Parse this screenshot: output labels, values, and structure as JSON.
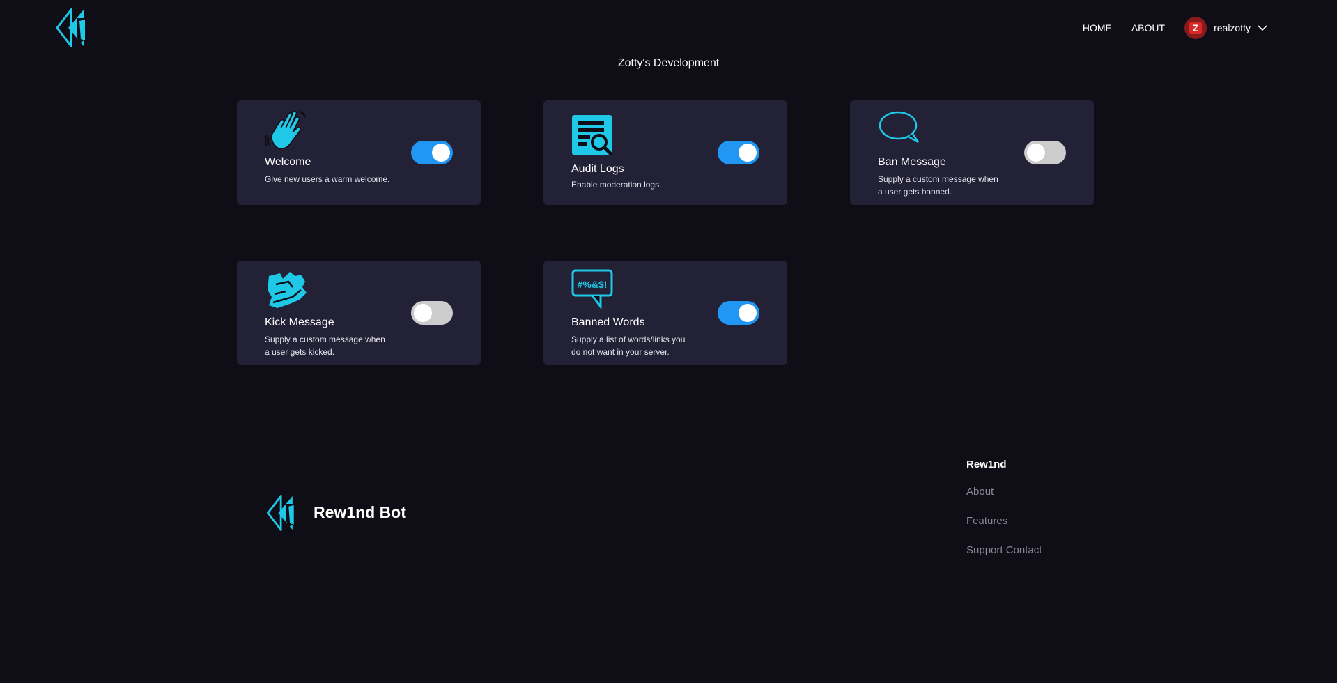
{
  "header": {
    "nav": [
      "HOME",
      "ABOUT"
    ],
    "username": "realzotty",
    "avatar_letter": "Z",
    "page_title": "Zotty's Development"
  },
  "cards": [
    {
      "title": "Welcome",
      "desc": "Give new users a warm welcome.",
      "enabled": true,
      "icon": "wave-hand-icon"
    },
    {
      "title": "Audit Logs",
      "desc": "Enable moderation logs.",
      "enabled": true,
      "icon": "audit-document-icon"
    },
    {
      "title": "Ban Message",
      "desc": "Supply a custom message when a user gets banned.",
      "enabled": false,
      "icon": "speech-bubble-icon"
    },
    {
      "title": "Kick Message",
      "desc": "Supply a custom message when a user gets kicked.",
      "enabled": false,
      "icon": "kick-shoe-icon"
    },
    {
      "title": "Banned Words",
      "desc": "Supply a list of words/links you do not want in your server.",
      "enabled": true,
      "icon": "censored-bubble-icon",
      "icon_text": "#%&$!"
    }
  ],
  "footer": {
    "brand": "Rew1nd Bot",
    "column_title": "Rew1nd",
    "links": [
      "About",
      "Features",
      "Support Contact"
    ]
  },
  "colors": {
    "background": "#0f0e17",
    "card": "#232136",
    "accent": "#1ec8e6",
    "toggle_on": "#2196f3",
    "toggle_off": "#cccccc"
  }
}
